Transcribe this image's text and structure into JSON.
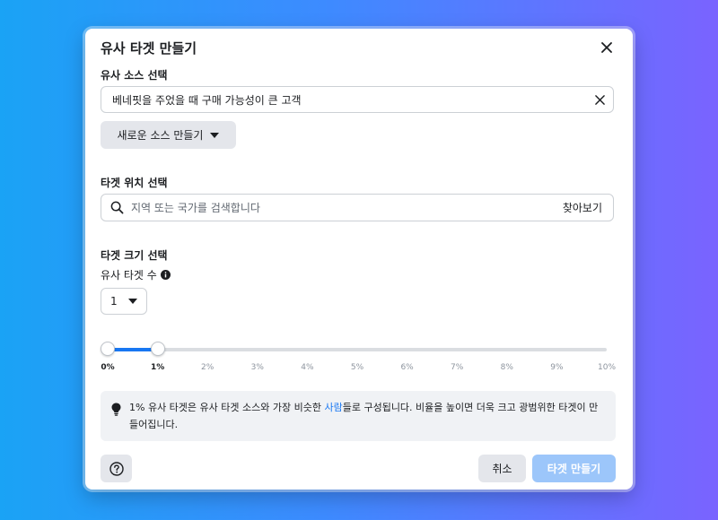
{
  "dialog": {
    "title": "유사 타겟 만들기"
  },
  "source": {
    "label": "유사 소스 선택",
    "value": "베네핏을 주었을 때 구매 가능성이 큰 고객",
    "new_source_button": "새로운 소스 만들기"
  },
  "location": {
    "label": "타겟 위치 선택",
    "placeholder": "지역 또는 국가를 검색합니다",
    "browse_label": "찾아보기"
  },
  "size": {
    "label": "타겟 크기 선택",
    "count_label": "유사 타겟 수",
    "count_value": "1",
    "slider": {
      "min": 0,
      "max": 10,
      "range_start": 0,
      "range_end": 1,
      "ticks": [
        "0%",
        "1%",
        "2%",
        "3%",
        "4%",
        "5%",
        "6%",
        "7%",
        "8%",
        "9%",
        "10%"
      ]
    }
  },
  "info": {
    "text_before": "1% 유사 타겟은 유사 타겟 소스와 가장 비슷한 ",
    "link": "사람",
    "text_after": "들로 구성됩니다. 비율을 높이면 더욱 크고 광범위한 타겟이 만들어집니다."
  },
  "footer": {
    "cancel_label": "취소",
    "create_label": "타겟 만들기"
  },
  "colors": {
    "accent": "#1877f2",
    "primary_disabled": "#9cc6fa",
    "grey_button": "#e4e6eb"
  }
}
